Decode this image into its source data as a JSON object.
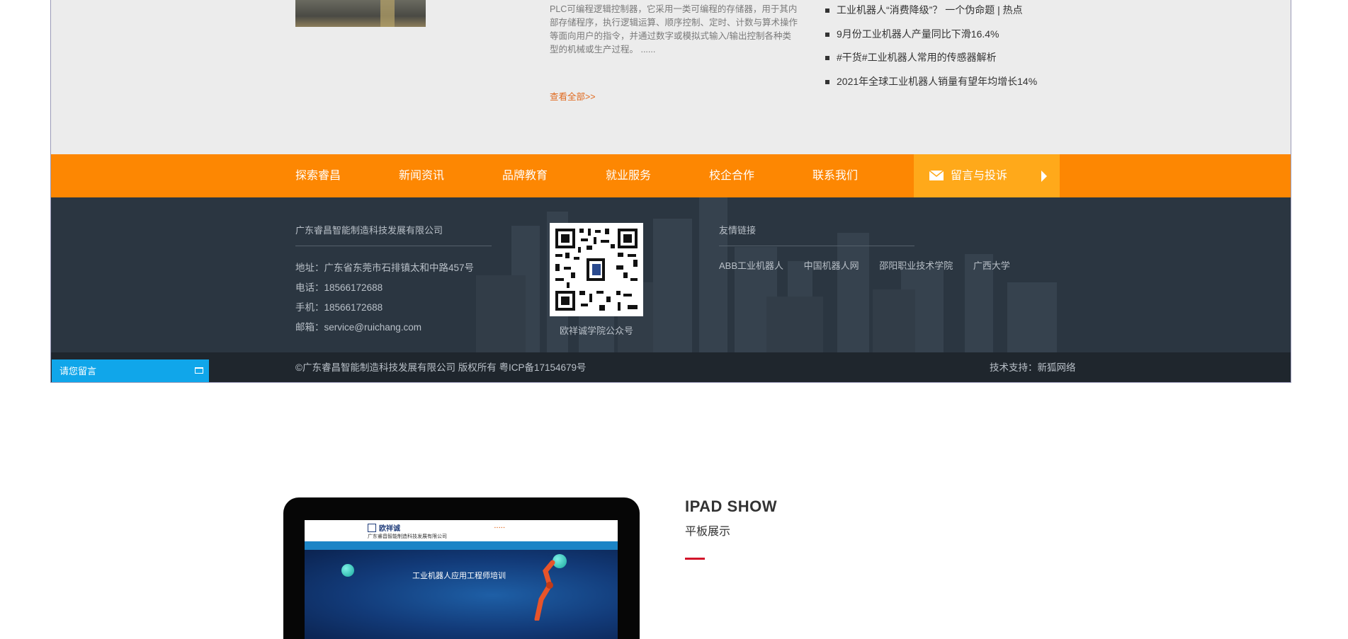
{
  "top": {
    "plc_desc": "PLC可编程逻辑控制器，它采用一类可编程的存储器，用于其内部存储程序，执行逻辑运算、顺序控制、定时、计数与算术操作等面向用户的指令，并通过数字或模拟式输入/输出控制各种类型的机械或生产过程。 ......",
    "view_all": "查看全部>>",
    "news": [
      "工业机器人“消费降级”？ 一个伪命题 | 热点",
      "9月份工业机器人产量同比下滑16.4%",
      "#干货#工业机器人常用的传感器解析",
      "2021年全球工业机器人销量有望年均增长14%"
    ]
  },
  "nav": {
    "items": [
      "探索睿昌",
      "新闻资讯",
      "品牌教育",
      "就业服务",
      "校企合作",
      "联系我们"
    ],
    "message_button": "留言与投诉"
  },
  "footer": {
    "company": "广东睿昌智能制造科技发展有限公司",
    "address": "地址：广东省东莞市石排镇太和中路457号",
    "phone": "电话：18566172688",
    "mobile": "手机：18566172688",
    "email": "邮箱：service@ruichang.com",
    "qr_caption": "欧祥诚学院公众号",
    "links_title": "友情链接",
    "links": [
      "ABB工业机器人",
      "中国机器人网",
      "邵阳职业技术学院",
      "广西大学"
    ],
    "copyright": "©广东睿昌智能制造科技发展有限公司  版权所有  粤ICP备17154679号",
    "support": "技术支持：新狐网络",
    "leave_message": "请您留言"
  },
  "ipad": {
    "title": "IPAD SHOW",
    "subtitle": "平板展示",
    "screen": {
      "logo": "欧祥诚",
      "company": "广东睿昌智能制造科技发展有限公司",
      "banner_title": "工业机器人应用工程师培训"
    }
  },
  "colors": {
    "nav_orange": "#fd8702",
    "message_orange": "#ffa91a",
    "footer_dark": "#2b3641",
    "leave_message_blue": "#10a6ea",
    "accent_red": "#d3142a"
  }
}
